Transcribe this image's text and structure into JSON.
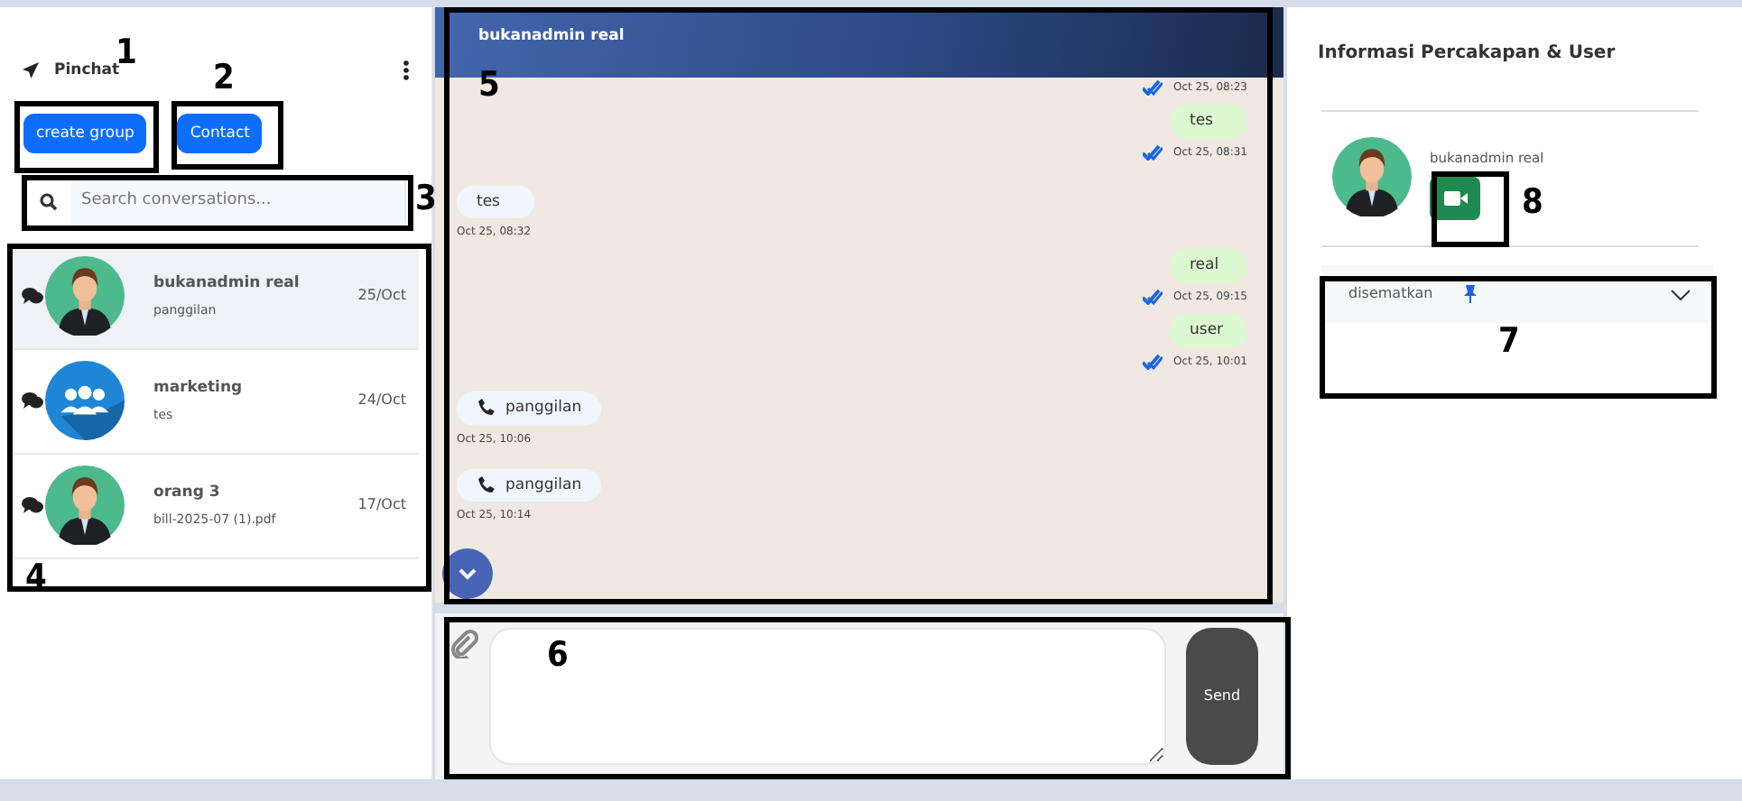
{
  "sidebar": {
    "title": "Pinchat",
    "buttons": [
      "create group",
      "Contact"
    ],
    "search": {
      "placeholder": "Search conversations..."
    },
    "conversations": [
      {
        "name": "bukanadmin real",
        "preview": "panggilan",
        "date": "25/Oct",
        "kind": "person",
        "selected": true
      },
      {
        "name": "marketing",
        "preview": "tes",
        "date": "24/Oct",
        "kind": "group",
        "selected": false
      },
      {
        "name": "orang 3",
        "preview": "bill-2025-07 (1).pdf",
        "date": "17/Oct",
        "kind": "person",
        "selected": false
      }
    ]
  },
  "chat": {
    "title": "bukanadmin real",
    "messages": [
      {
        "kind": "out",
        "time": "Oct 25, 08:23"
      },
      {
        "kind": "out",
        "text": "tes",
        "time": "Oct 25, 08:31"
      },
      {
        "kind": "in",
        "text": "tes",
        "time": "Oct 25, 08:32"
      },
      {
        "kind": "out",
        "text": "real",
        "time": "Oct 25, 09:15"
      },
      {
        "kind": "out",
        "text": "user",
        "time": "Oct 25, 10:01"
      },
      {
        "kind": "call",
        "text": "panggilan",
        "time": "Oct 25, 10:06"
      },
      {
        "kind": "call",
        "text": "panggilan",
        "time": "Oct 25, 10:14"
      }
    ]
  },
  "composer": {
    "button": "Send"
  },
  "info": {
    "title": "Informasi Percakapan & User",
    "name": "bukanadmin real",
    "pinned": {
      "label": "disematkan",
      "expanded": false
    }
  },
  "annotations": [
    {
      "label": "1"
    },
    {
      "label": "2"
    },
    {
      "label": "3"
    },
    {
      "label": "4"
    },
    {
      "label": "5"
    },
    {
      "label": "6"
    },
    {
      "label": "7"
    },
    {
      "label": "8"
    }
  ]
}
